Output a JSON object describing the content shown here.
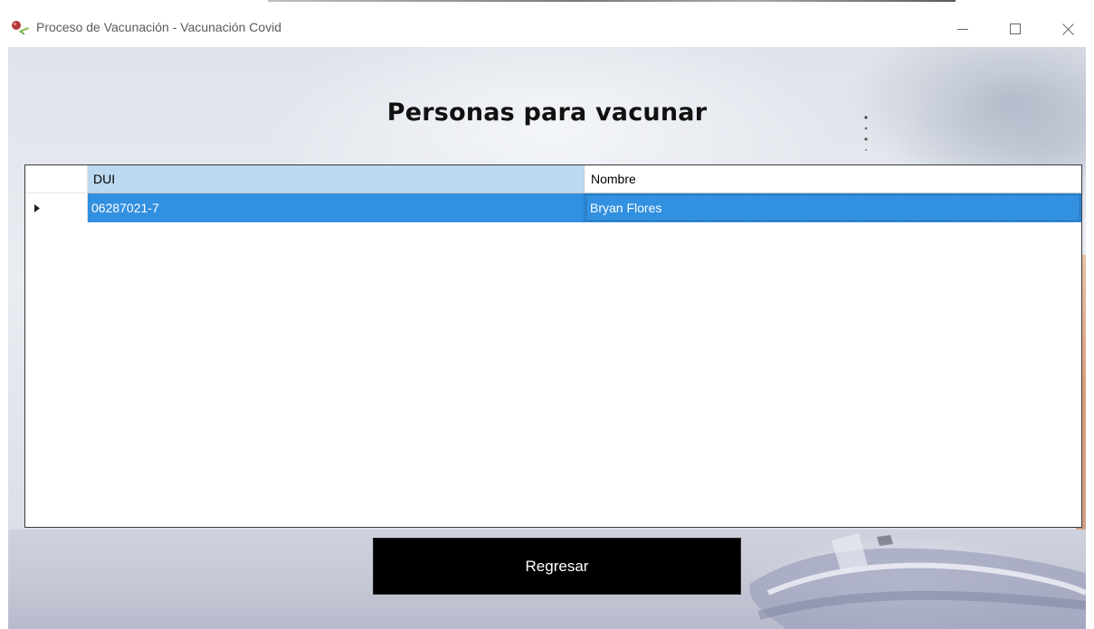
{
  "window": {
    "title": "Proceso de Vacunación - Vacunación Covid",
    "icon": "vaccine-app-icon",
    "controls": [
      "minimize-icon",
      "maximize-icon",
      "close-icon"
    ]
  },
  "page": {
    "title": "Personas para vacunar"
  },
  "grid": {
    "columns": [
      "DUI",
      "Nombre"
    ],
    "rows": [
      {
        "dui": "06287021-7",
        "nombre": "Bryan Flores",
        "selected": true
      }
    ],
    "selection_color": "#3290e0",
    "header_highlight_color": "#bcd9ef"
  },
  "actions": {
    "back_label": "Regresar"
  }
}
